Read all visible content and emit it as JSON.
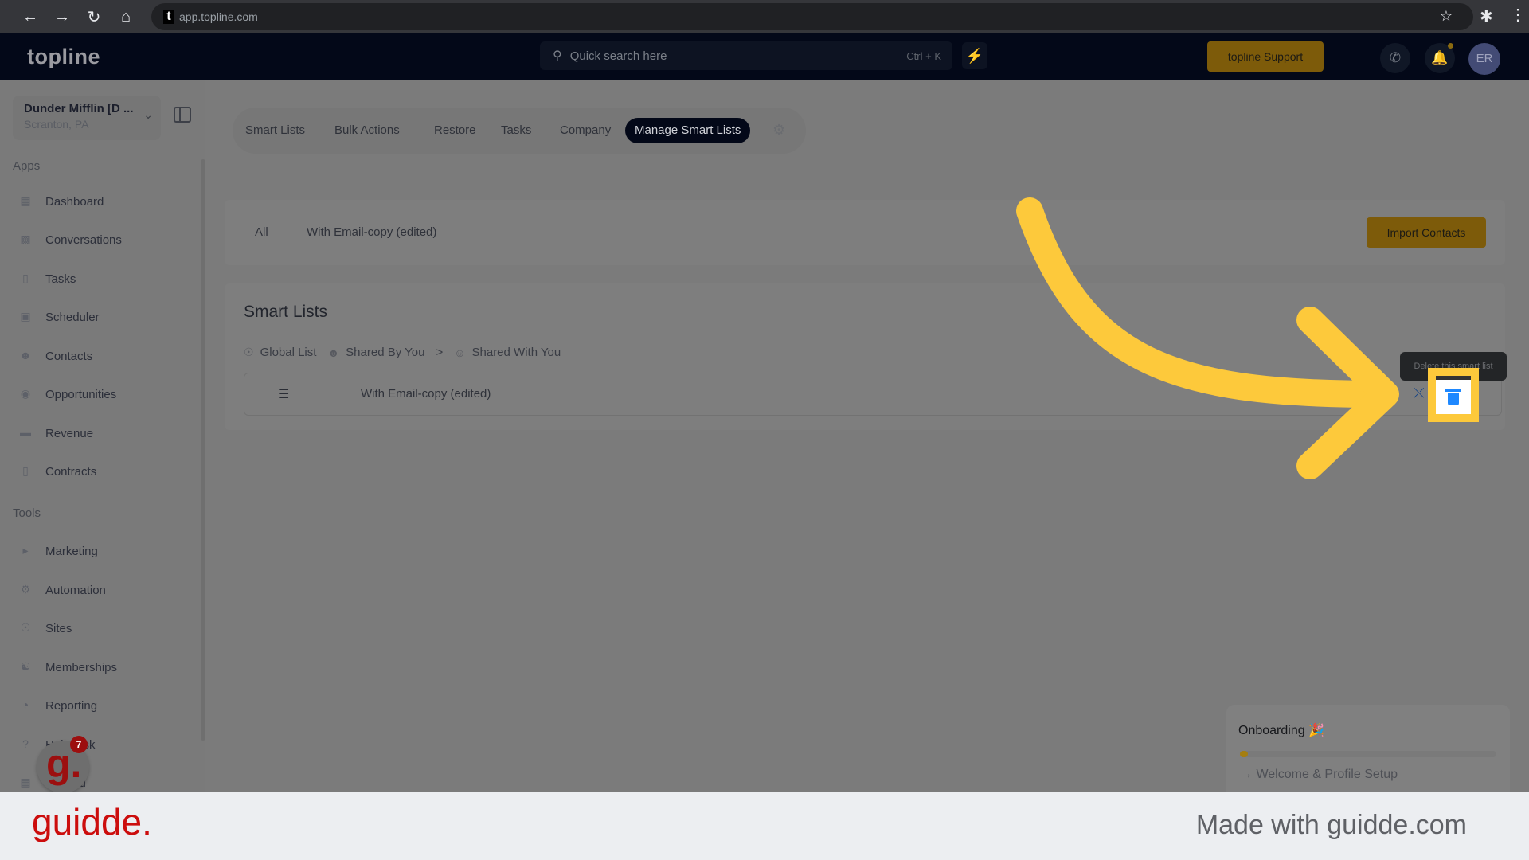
{
  "browser": {
    "url": "app.topline.com",
    "favicon_letter": "t",
    "icons": [
      "back-icon",
      "forward-icon",
      "reload-icon",
      "home-icon",
      "star-icon",
      "extensions-icon",
      "menu-icon"
    ]
  },
  "header": {
    "logo": "topline",
    "search_placeholder": "Quick search here",
    "search_shortcut": "Ctrl + K",
    "support_label": "topline Support",
    "avatar_initials": "ER"
  },
  "sidebar": {
    "company_name": "Dunder Mifflin [D ...",
    "company_location": "Scranton, PA",
    "apps_label": "Apps",
    "apps": [
      {
        "label": "Dashboard",
        "icon": "dashboard-icon"
      },
      {
        "label": "Conversations",
        "icon": "chat-icon"
      },
      {
        "label": "Tasks",
        "icon": "tasks-icon"
      },
      {
        "label": "Scheduler",
        "icon": "calendar-icon"
      },
      {
        "label": "Contacts",
        "icon": "contacts-icon"
      },
      {
        "label": "Opportunities",
        "icon": "opportunities-icon"
      },
      {
        "label": "Revenue",
        "icon": "revenue-icon"
      },
      {
        "label": "Contracts",
        "icon": "contracts-icon"
      }
    ],
    "tools_label": "Tools",
    "tools": [
      {
        "label": "Marketing",
        "icon": "megaphone-icon"
      },
      {
        "label": "Automation",
        "icon": "gears-icon"
      },
      {
        "label": "Sites",
        "icon": "globe-icon"
      },
      {
        "label": "Memberships",
        "icon": "memberships-icon"
      },
      {
        "label": "Reporting",
        "icon": "pie-chart-icon"
      },
      {
        "label": "Helpdesk",
        "icon": "help-icon"
      },
      {
        "label": "Rebuild",
        "icon": "rebuild-icon"
      }
    ]
  },
  "tabs": [
    {
      "label": "Smart Lists",
      "active": false
    },
    {
      "label": "Bulk Actions",
      "active": false
    },
    {
      "label": "Restore",
      "active": false
    },
    {
      "label": "Tasks",
      "active": false
    },
    {
      "label": "Company",
      "active": false
    },
    {
      "label": "Manage Smart Lists",
      "active": true
    }
  ],
  "filters": {
    "all": "All",
    "item": "With Email-copy (edited)",
    "import_label": "Import Contacts"
  },
  "smart_lists": {
    "title": "Smart Lists",
    "crumbs": [
      {
        "label": "Global List",
        "icon": "globe-icon"
      },
      {
        "label": "Shared By You",
        "icon": "user-plus-icon"
      },
      {
        "label": "Shared With You",
        "icon": "users-icon"
      }
    ],
    "crumb_separator": ">",
    "rows": [
      {
        "name": "With Email-copy (edited)"
      }
    ],
    "delete_tooltip": "Delete this smart list"
  },
  "onboarding": {
    "title": "Onboarding",
    "emoji": "🎉",
    "progress_percent": 3,
    "step": "Welcome & Profile Setup"
  },
  "guidde": {
    "badge_count": "7",
    "brand": "guidde.",
    "made_with": "Made with guidde.com"
  },
  "colors": {
    "highlight": "#fdc93b",
    "accent_gold": "#c99a13",
    "delete_blue": "#1e88ff",
    "guidde_red": "#cc0d0d"
  }
}
